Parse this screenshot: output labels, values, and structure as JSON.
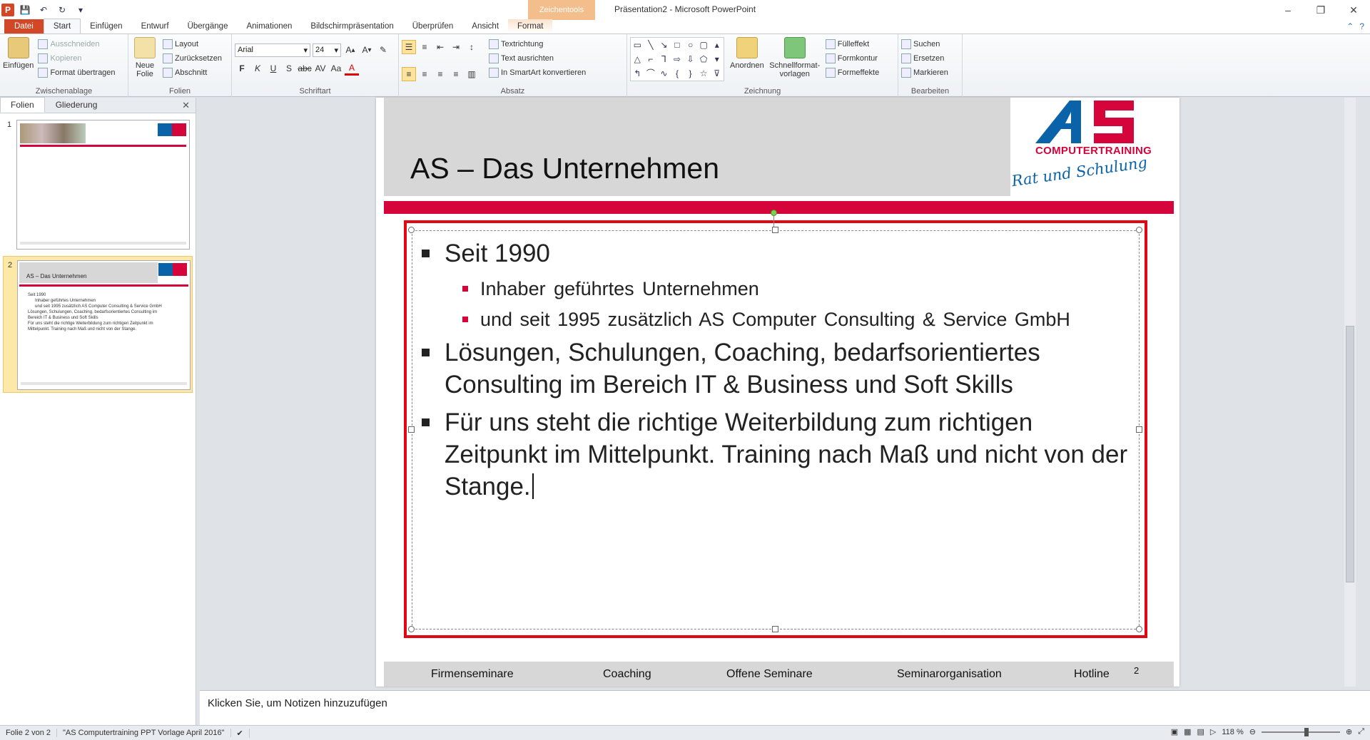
{
  "window": {
    "title": "Präsentation2 - Microsoft PowerPoint",
    "context_group": "Zeichentools",
    "minimize": "–",
    "restore": "❐",
    "close": "✕"
  },
  "tabs": [
    "Datei",
    "Start",
    "Einfügen",
    "Entwurf",
    "Übergänge",
    "Animationen",
    "Bildschirmpräsentation",
    "Überprüfen",
    "Ansicht",
    "Format"
  ],
  "ribbon": {
    "clipboard": {
      "paste": "Einfügen",
      "cut": "Ausschneiden",
      "copy": "Kopieren",
      "format_painter": "Format übertragen",
      "label": "Zwischenablage"
    },
    "slides": {
      "new_slide": "Neue Folie",
      "layout": "Layout",
      "reset": "Zurücksetzen",
      "section": "Abschnitt",
      "label": "Folien"
    },
    "font": {
      "name": "Arial",
      "size": "24",
      "label": "Schriftart"
    },
    "paragraph": {
      "text_direction": "Textrichtung",
      "align_text": "Text ausrichten",
      "smartart": "In SmartArt konvertieren",
      "label": "Absatz"
    },
    "drawing": {
      "arrange": "Anordnen",
      "quick_styles": "Schnellformat-vorlagen",
      "fill": "Fülleffekt",
      "outline": "Formkontur",
      "effects": "Formeffekte",
      "label": "Zeichnung"
    },
    "editing": {
      "find": "Suchen",
      "replace": "Ersetzen",
      "select": "Markieren",
      "label": "Bearbeiten"
    }
  },
  "left_pane": {
    "tab_slides": "Folien",
    "tab_outline": "Gliederung",
    "slide1_num": "1",
    "slide2_num": "2",
    "thumb2_title": "AS – Das Unternehmen"
  },
  "slide": {
    "title": "AS – Das Unternehmen",
    "logo_text": "COMPUTERTRAINING",
    "logo_script": "Rat und Schulung",
    "bullets": [
      {
        "text": "Seit 1990",
        "sub": [
          "Inhaber geführtes Unternehmen",
          "und seit 1995 zusätzlich AS Computer Consulting & Service GmbH"
        ]
      },
      {
        "text": "Lösungen, Schulungen, Coaching, bedarfsorientiertes Consulting im Bereich IT & Business und Soft Skills"
      },
      {
        "text": "Für uns steht die richtige Weiterbildung zum richtigen Zeitpunkt im Mittelpunkt. Training nach Maß und nicht von der Stange."
      }
    ],
    "footer": [
      "Firmenseminare",
      "Coaching",
      "Offene Seminare",
      "Seminarorganisation",
      "Hotline"
    ],
    "page_number": "2"
  },
  "notes_placeholder": "Klicken Sie, um Notizen hinzuzufügen",
  "status": {
    "slide_of": "Folie 2 von 2",
    "theme": "\"AS Computertraining PPT Vorlage April 2016\"",
    "zoom": "118 %"
  },
  "colors": {
    "brand_pink": "#d5053c",
    "brand_blue": "#0a63a8",
    "file_tab": "#d24726"
  }
}
